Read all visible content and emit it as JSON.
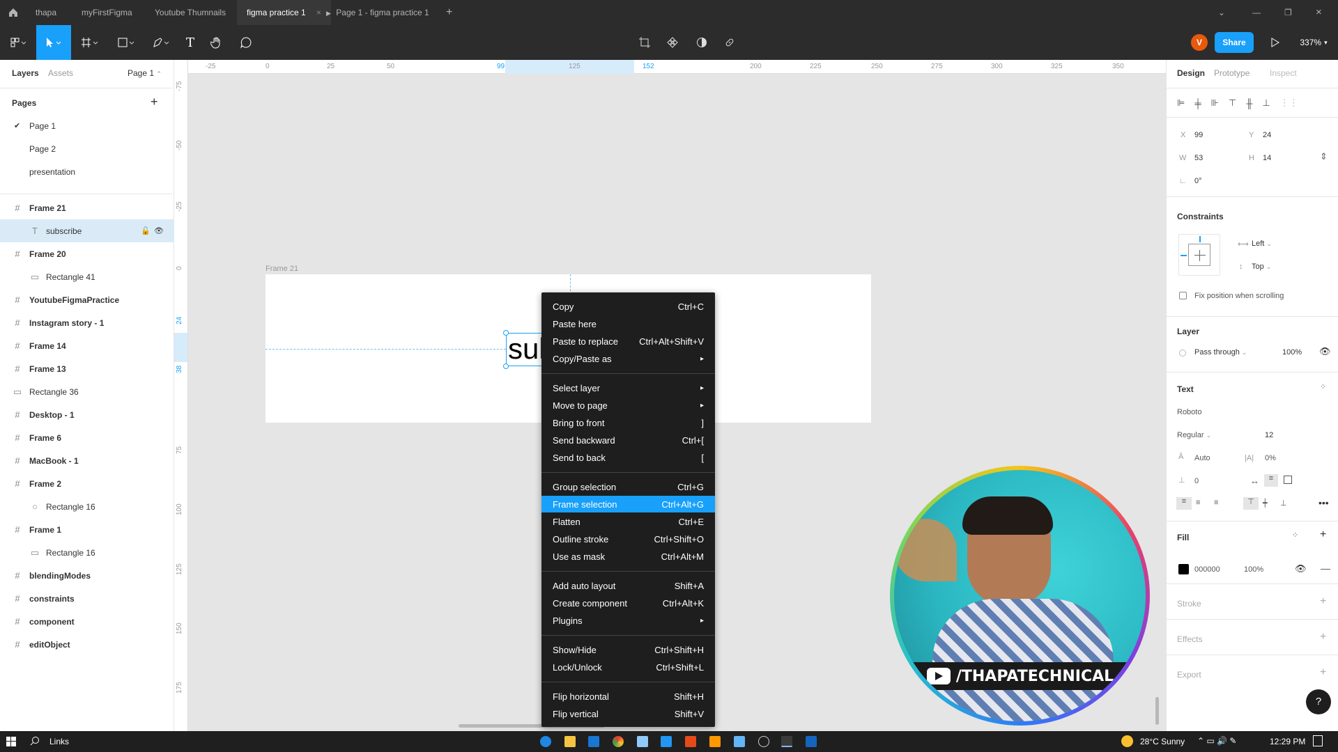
{
  "titlebar": {
    "tabs": [
      "thapa",
      "myFirstFigma",
      "Youtube Thumnails",
      "figma practice 1",
      "Page 1 - figma practice 1"
    ],
    "new_tab": "+"
  },
  "toolbar": {
    "avatar_letter": "V",
    "share_label": "Share",
    "zoom": "337%"
  },
  "left_panel": {
    "tab_layers": "Layers",
    "tab_assets": "Assets",
    "page_selector": "Page 1",
    "pages_title": "Pages",
    "pages": [
      "Page 1",
      "Page 2",
      "presentation"
    ],
    "layers": [
      {
        "name": "Frame 21",
        "kind": "frame",
        "indent": 0
      },
      {
        "name": "subscribe",
        "kind": "text",
        "indent": 1
      },
      {
        "name": "Frame 20",
        "kind": "frame",
        "indent": 0
      },
      {
        "name": "Rectangle 41",
        "kind": "rect",
        "indent": 1
      },
      {
        "name": "YoutubeFigmaPractice",
        "kind": "frame",
        "indent": 0
      },
      {
        "name": "Instagram story - 1",
        "kind": "frame",
        "indent": 0
      },
      {
        "name": "Frame 14",
        "kind": "frame",
        "indent": 0
      },
      {
        "name": "Frame 13",
        "kind": "frame",
        "indent": 0
      },
      {
        "name": "Rectangle 36",
        "kind": "rect",
        "indent": 0
      },
      {
        "name": "Desktop - 1",
        "kind": "frame",
        "indent": 0
      },
      {
        "name": "Frame 6",
        "kind": "frame",
        "indent": 0
      },
      {
        "name": "MacBook - 1",
        "kind": "frame",
        "indent": 0
      },
      {
        "name": "Frame 2",
        "kind": "frame",
        "indent": 0
      },
      {
        "name": "Rectangle 16",
        "kind": "ellipse",
        "indent": 1
      },
      {
        "name": "Frame 1",
        "kind": "frame",
        "indent": 0
      },
      {
        "name": "Rectangle 16",
        "kind": "rect",
        "indent": 1
      },
      {
        "name": "blendingModes",
        "kind": "frame",
        "indent": 0
      },
      {
        "name": "constraints",
        "kind": "frame",
        "indent": 0
      },
      {
        "name": "component",
        "kind": "frame",
        "indent": 0
      },
      {
        "name": "editObject",
        "kind": "frame",
        "indent": 0
      }
    ]
  },
  "rulers": {
    "top": [
      "-25",
      "0",
      "25",
      "50",
      "99",
      "125",
      "152",
      "200",
      "225",
      "250",
      "275",
      "300",
      "325",
      "350"
    ],
    "left": [
      "-75",
      "-50",
      "-25",
      "0",
      "24",
      "38",
      "75",
      "100",
      "125",
      "150",
      "175"
    ]
  },
  "canvas": {
    "frame_label": "Frame 21",
    "text_content": "sub"
  },
  "context_menu": {
    "groups": [
      [
        {
          "label": "Copy",
          "shortcut": "Ctrl+C"
        },
        {
          "label": "Paste here",
          "shortcut": ""
        },
        {
          "label": "Paste to replace",
          "shortcut": "Ctrl+Alt+Shift+V"
        },
        {
          "label": "Copy/Paste as",
          "shortcut": "▸"
        }
      ],
      [
        {
          "label": "Select layer",
          "shortcut": "▸"
        },
        {
          "label": "Move to page",
          "shortcut": "▸"
        },
        {
          "label": "Bring to front",
          "shortcut": "]"
        },
        {
          "label": "Send backward",
          "shortcut": "Ctrl+["
        },
        {
          "label": "Send to back",
          "shortcut": "["
        }
      ],
      [
        {
          "label": "Group selection",
          "shortcut": "Ctrl+G"
        },
        {
          "label": "Frame selection",
          "shortcut": "Ctrl+Alt+G",
          "highlighted": true
        },
        {
          "label": "Flatten",
          "shortcut": "Ctrl+E"
        },
        {
          "label": "Outline stroke",
          "shortcut": "Ctrl+Shift+O"
        },
        {
          "label": "Use as mask",
          "shortcut": "Ctrl+Alt+M"
        }
      ],
      [
        {
          "label": "Add auto layout",
          "shortcut": "Shift+A"
        },
        {
          "label": "Create component",
          "shortcut": "Ctrl+Alt+K"
        },
        {
          "label": "Plugins",
          "shortcut": "▸"
        }
      ],
      [
        {
          "label": "Show/Hide",
          "shortcut": "Ctrl+Shift+H"
        },
        {
          "label": "Lock/Unlock",
          "shortcut": "Ctrl+Shift+L"
        }
      ],
      [
        {
          "label": "Flip horizontal",
          "shortcut": "Shift+H"
        },
        {
          "label": "Flip vertical",
          "shortcut": "Shift+V"
        }
      ]
    ]
  },
  "right_panel": {
    "tabs": [
      "Design",
      "Prototype",
      "Inspect"
    ],
    "x_label": "X",
    "x_value": "99",
    "y_label": "Y",
    "y_value": "24",
    "w_label": "W",
    "w_value": "53",
    "h_label": "H",
    "h_value": "14",
    "rotation": "0°",
    "constraints_title": "Constraints",
    "constraint_h": "Left",
    "constraint_v": "Top",
    "fix_position": "Fix position when scrolling",
    "layer_title": "Layer",
    "blend_mode": "Pass through",
    "layer_opacity": "100%",
    "text_title": "Text",
    "font_family": "Roboto",
    "font_weight": "Regular",
    "font_size": "12",
    "line_height": "Auto",
    "letter_spacing": "0%",
    "paragraph_spacing": "0",
    "fill_title": "Fill",
    "fill_hex": "000000",
    "fill_opacity": "100%",
    "stroke_title": "Stroke",
    "effects_title": "Effects",
    "export_title": "Export",
    "help": "?"
  },
  "webcam": {
    "channel": "/THAPATECHNICAL"
  },
  "taskbar": {
    "links": "Links",
    "weather": "28°C  Sunny",
    "time": "12:29 PM"
  },
  "colors": {
    "accent": "#18a0fb",
    "toolbar_bg": "#2c2c2c",
    "menu_bg": "#1e1e1e",
    "avatar": "#e8590c"
  }
}
